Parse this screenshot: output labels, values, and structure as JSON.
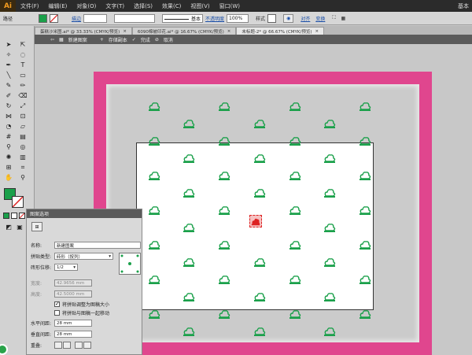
{
  "menubar": {
    "logo": "Ai",
    "items": [
      "文件(F)",
      "编辑(E)",
      "对象(O)",
      "文字(T)",
      "选择(S)",
      "效果(C)",
      "视图(V)",
      "窗口(W)"
    ],
    "right": "基本"
  },
  "control": {
    "path_label": "路径",
    "fill_color": "#1aa04a",
    "stroke_label": "描边",
    "stroke_style": "基本",
    "opacity_label": "不透明度",
    "opacity_value": "100%",
    "style_label": "样式",
    "align_label": "对齐",
    "transform_label": "变换"
  },
  "tabs": [
    {
      "label": "蛋糕沙米图.ai* @ 33.33% (CMYK/预览)",
      "active": false
    },
    {
      "label": "6090棉被印花.ai* @ 16.67% (CMYK/预览)",
      "active": false
    },
    {
      "label": "未标题-2* @ 66.67% (CMYK/预览)",
      "active": true
    }
  ],
  "modebar": {
    "new_pattern": "新建图案",
    "save_copy": "存储副本",
    "done": "完成",
    "cancel": "取消"
  },
  "panel": {
    "title": "图案选项",
    "name_label": "名称:",
    "name_value": "新建图案",
    "tile_type_label": "拼贴类型:",
    "tile_type_value": "砖形（按列）",
    "brick_offset_label": "砖形位移:",
    "brick_offset_value": "1/2",
    "width_label": "宽度:",
    "width_value": "42.9656 mm",
    "height_label": "高度:",
    "height_value": "42.5000 mm",
    "resize_tile_label": "将拼贴调整为图稿大小",
    "move_tile_label": "将拼贴与图稿一起移动",
    "h_spacing_label": "水平间距:",
    "h_spacing_value": "28 mm",
    "v_spacing_label": "垂直间距:",
    "v_spacing_value": "28 mm",
    "overlap_label": "重叠:"
  },
  "colors": {
    "frame": "#e0468e",
    "motif": "#1aa04a",
    "accent": "#1b4fa8"
  },
  "icons": {
    "motif": "cloud-tree-icon",
    "center": "selected-motif-icon"
  }
}
